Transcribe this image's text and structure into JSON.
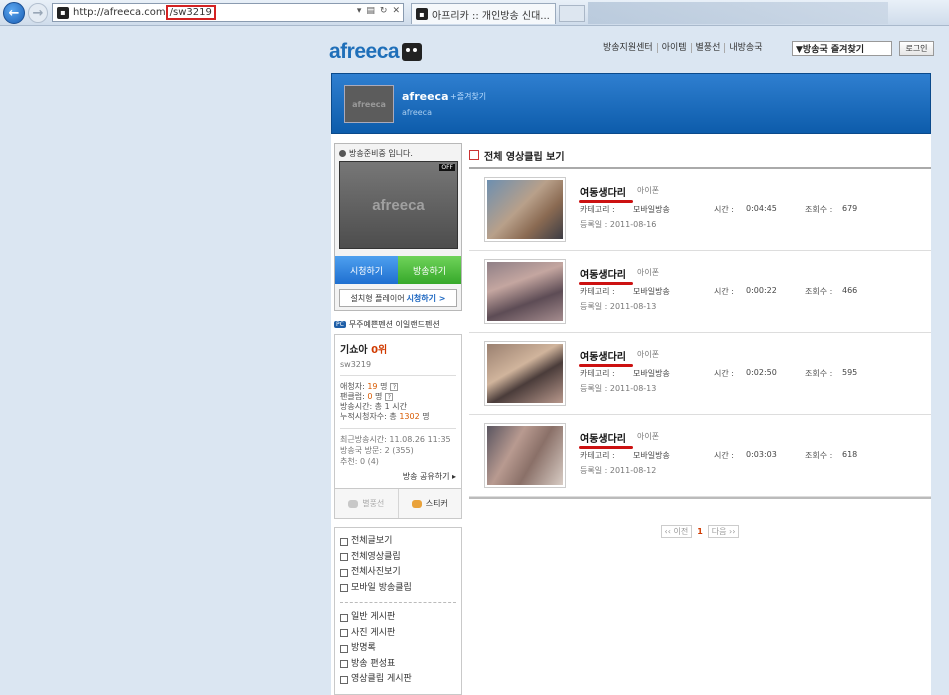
{
  "browser": {
    "url_host": "http://afreeca.com",
    "url_path": "/sw3219",
    "tab_title": "아프리카 :: 개인방송 신대..."
  },
  "header": {
    "logo": "afreeca",
    "nav": [
      "방송지원센터",
      "아이템",
      "별풍선",
      "내방송국"
    ],
    "favorites_select": "▼방송국 즐겨찾기",
    "login": "로그인"
  },
  "banner": {
    "name": "afreeca",
    "add_favorite": "+즐겨찾기",
    "id": "afreeca"
  },
  "player": {
    "status": "방송준비중 입니다.",
    "off_badge": "OFF",
    "screen_logo": "afreeca",
    "watch_label": "시청하기",
    "broadcast_label": "방송하기",
    "install_text": "설치형 플레이어",
    "install_link": "시청하기 >"
  },
  "station": {
    "badge": "PC",
    "text": "무주예쁜펜션 이일랜드펜션"
  },
  "profile": {
    "name": "기쇼아",
    "rank": "0위",
    "id": "sw3219",
    "fans_label": "애청자:",
    "fans_value": "19",
    "fans_unit": "명",
    "fanclub_label": "팬클럽:",
    "fanclub_value": "0",
    "fanclub_unit": "명",
    "airtime": "방송시간: 총 1 시간",
    "viewers_label": "누적시청자수: 총",
    "viewers_value": "1302",
    "viewers_unit": "명",
    "recent_broadcast": "최근방송시간: 11.08.26 11:35",
    "visits": "방송국 방문: 2 (355)",
    "recommend": "추천: 0 (4)",
    "share": "방송 공유하기 ▸"
  },
  "tools": {
    "star_balloon": "별풍선",
    "sticker": "스티커"
  },
  "menu": {
    "group1": [
      "전체글보기",
      "전체영상클립",
      "전체사진보기",
      "모바일 방송클립"
    ],
    "group2": [
      "일반 게시판",
      "사진 게시판",
      "방명록",
      "방송 편성표",
      "영상클립 게시판"
    ]
  },
  "main": {
    "title": "전체 영상클립 보기",
    "labels": {
      "category": "카테고리 :",
      "time": "시간 :",
      "views": "조회수 :"
    },
    "clips": [
      {
        "title": "여동생다리",
        "platform": "아이폰",
        "category": "모바일방송",
        "time": "0:04:45",
        "views": "679",
        "date": "등록일 : 2011-08-16"
      },
      {
        "title": "여동생다리",
        "platform": "아이폰",
        "category": "모바일방송",
        "time": "0:00:22",
        "views": "466",
        "date": "등록일 : 2011-08-13"
      },
      {
        "title": "여동생다리",
        "platform": "아이폰",
        "category": "모바일방송",
        "time": "0:02:50",
        "views": "595",
        "date": "등록일 : 2011-08-13"
      },
      {
        "title": "여동생다리",
        "platform": "아이폰",
        "category": "모바일방송",
        "time": "0:03:03",
        "views": "618",
        "date": "등록일 : 2011-08-12"
      }
    ],
    "pager": {
      "prev": "‹‹ 이전",
      "current": "1",
      "next": "다음 ››"
    }
  }
}
